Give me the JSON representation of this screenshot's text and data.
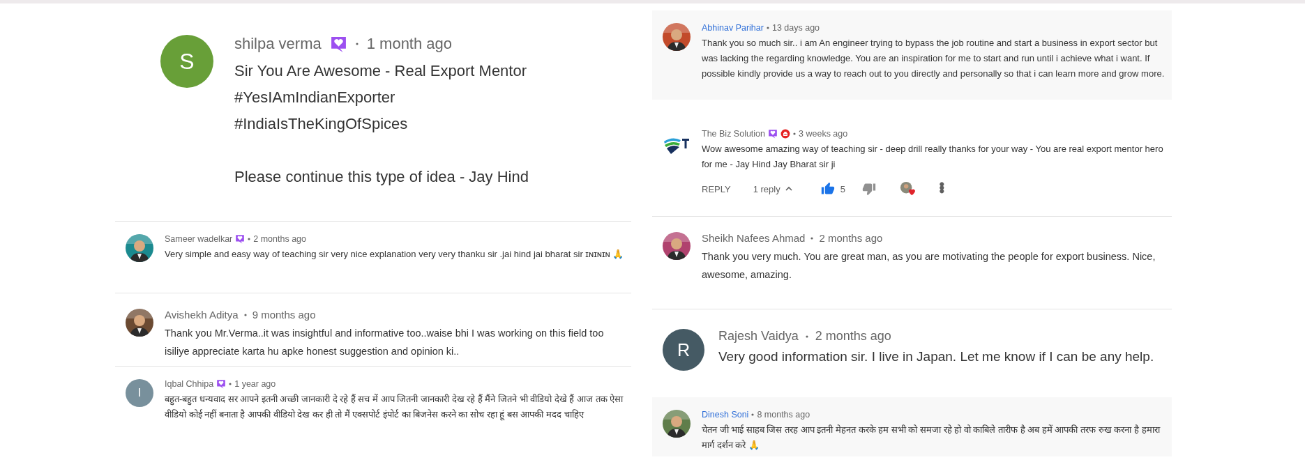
{
  "columns": [
    {
      "comments": [
        {
          "kind": "large",
          "highlighted": false,
          "avatar": {
            "kind": "letter",
            "letter": "S",
            "color": "#689f38"
          },
          "author": "shilpa verma",
          "member_badge": true,
          "owner_badge": false,
          "time": "1 month ago",
          "text": [
            "Sir You Are Awesome - Real Export Mentor\n#YesIAmIndianExporter\n#IndiaIsTheKingOfSpices\n\nPlease continue this type of idea - Jay Hind"
          ]
        },
        {
          "kind": "small",
          "highlighted": false,
          "avatar": {
            "kind": "picture"
          },
          "author": "Sameer wadelkar",
          "member_badge": true,
          "owner_badge": false,
          "time": "2 months ago",
          "text": [
            "Very simple and easy way of teaching sir very nice explanation very very thanku sir .jai hind jai bharat sir ɪɴɪɴɪɴ 🙏"
          ]
        },
        {
          "kind": "medium",
          "highlighted": false,
          "avatar": {
            "kind": "picture"
          },
          "author": "Avishekh Aditya",
          "member_badge": false,
          "owner_badge": false,
          "time": "9 months ago",
          "text": [
            "Thank you Mr.Verma..it was insightful and informative too..waise bhi I was working on this field too isiliye appreciate karta hu apke honest suggestion and opinion ki.."
          ]
        },
        {
          "kind": "small",
          "highlighted": false,
          "avatar": {
            "kind": "letter",
            "letter": "I",
            "color": "#78909c"
          },
          "author": "Iqbal Chhipa",
          "member_badge": true,
          "owner_badge": false,
          "time": "1 year ago",
          "text": [
            "बहुत-बहुत धन्यवाद सर आपने इतनी अच्छी जानकारी दे रहे हैं सच में आप जितनी जानकारी देख रहे हैं मैंने जितने भी वीडियो देखे हैं आज तक ऐसा वीडियो कोई नहीं बनाता है आपकी वीडियो देख कर ही तो मैं एक्सपोर्ट इंपोर्ट का बिजनेस करने का सोच रहा हूं बस आपकी मदद चाहिए"
          ]
        }
      ]
    },
    {
      "comments": [
        {
          "kind": "small",
          "highlighted": true,
          "avatar": {
            "kind": "picture"
          },
          "author": "Abhinav Parihar",
          "member_badge": false,
          "owner_badge": false,
          "time": "13 days ago",
          "text": [
            "Thank you so much sir.. i am An engineer trying to bypass the job routine and start a business in export sector but was lacking the regarding knowledge. You are an inspiration for me to start and run until i achieve what i want.  If possible kindly provide us a way to reach out to you directly and personally so that i can learn more and grow more."
          ]
        },
        {
          "kind": "small",
          "highlighted": false,
          "avatar": {
            "kind": "logo"
          },
          "author": "The Biz Solution",
          "member_badge": true,
          "owner_badge": true,
          "time": "3 weeks ago",
          "text": [
            "Wow awesome amazing way of teaching sir - deep drill really thanks for your way - You are real export mentor hero for me - Jay Hind Jay Bharat sir ji"
          ],
          "actions": {
            "reply": "REPLY",
            "replies": "1 reply",
            "expanded": true,
            "likes": "5",
            "liked": true,
            "hearted": true
          }
        },
        {
          "kind": "medium",
          "highlighted": false,
          "avatar": {
            "kind": "picture"
          },
          "author": "Sheikh Nafees Ahmad",
          "member_badge": false,
          "owner_badge": false,
          "time": "2 months ago",
          "text": [
            "Thank you very much. You are great man, as you are motivating the people for export business. Nice, awesome, amazing."
          ]
        },
        {
          "kind": "big",
          "highlighted": false,
          "avatar": {
            "kind": "letter",
            "letter": "R",
            "color": "#455a64"
          },
          "author": "Rajesh Vaidya",
          "member_badge": false,
          "owner_badge": false,
          "time": "2 months ago",
          "text": [
            "Very good information sir. I live in Japan. Let me know if I can be any help."
          ]
        },
        {
          "kind": "small",
          "highlighted": true,
          "avatar": {
            "kind": "picture"
          },
          "author": "Dinesh Soni",
          "member_badge": false,
          "owner_badge": false,
          "time": "8 months ago",
          "text": [
            "चेतन जी भाई साहब जिस तरह आप इतनी मेहनत करके हम सभी को समजा रहे हो वो काबिले तारीफ है अब हमें आपकी तरफ रुख करना है हमारा मार्ग दर्शन करे 🙏"
          ]
        }
      ]
    }
  ]
}
